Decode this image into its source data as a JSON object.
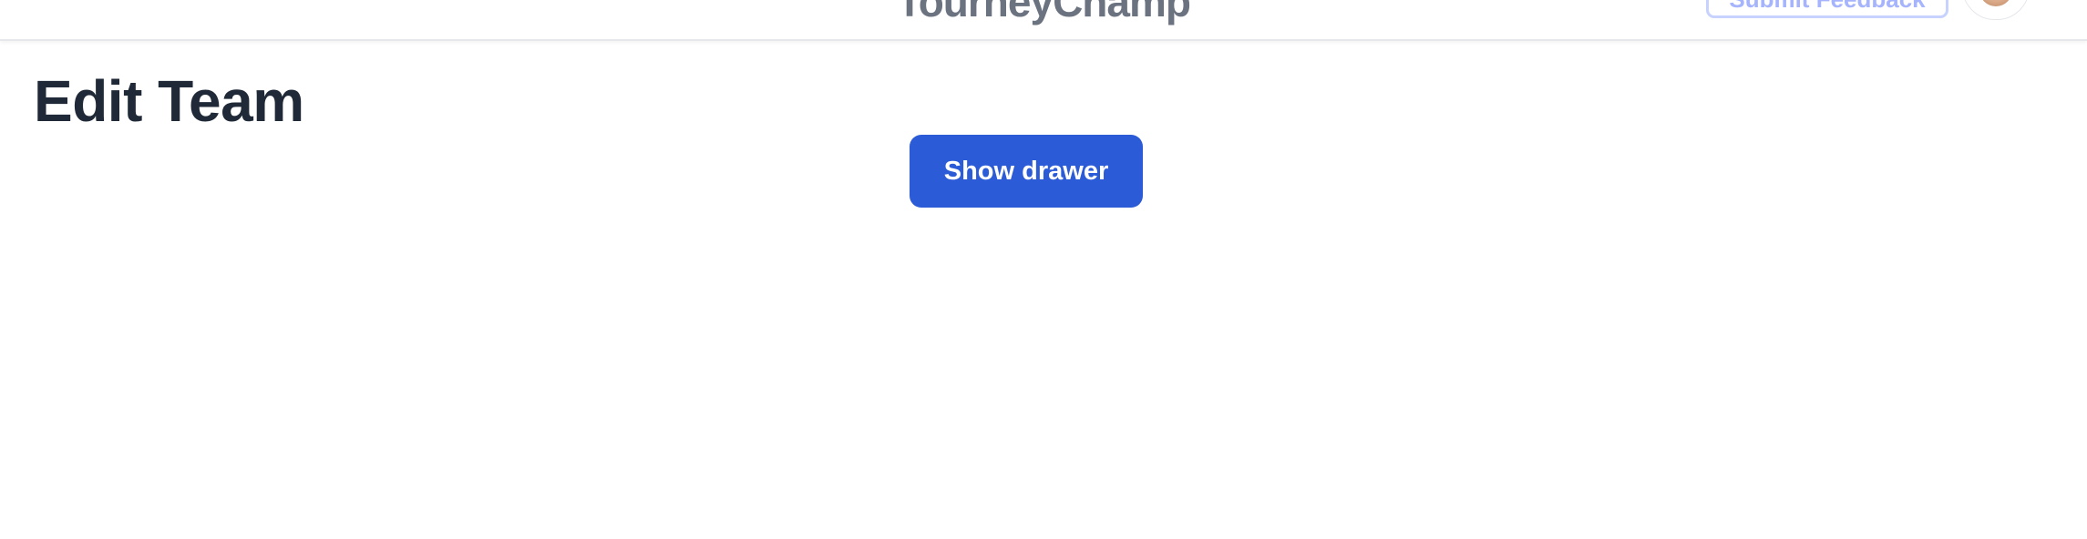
{
  "header": {
    "brand": "TourneyChamp",
    "feedback_label": "Submit Feedback",
    "avatar_icon": "user-avatar-icon"
  },
  "main": {
    "title": "Edit Team",
    "show_drawer_label": "Show drawer"
  },
  "colors": {
    "primary_button": "#2b5bd7",
    "title_text": "#1f2937",
    "brand_text": "#6b7280",
    "feedback_border": "#c7d2fe"
  }
}
